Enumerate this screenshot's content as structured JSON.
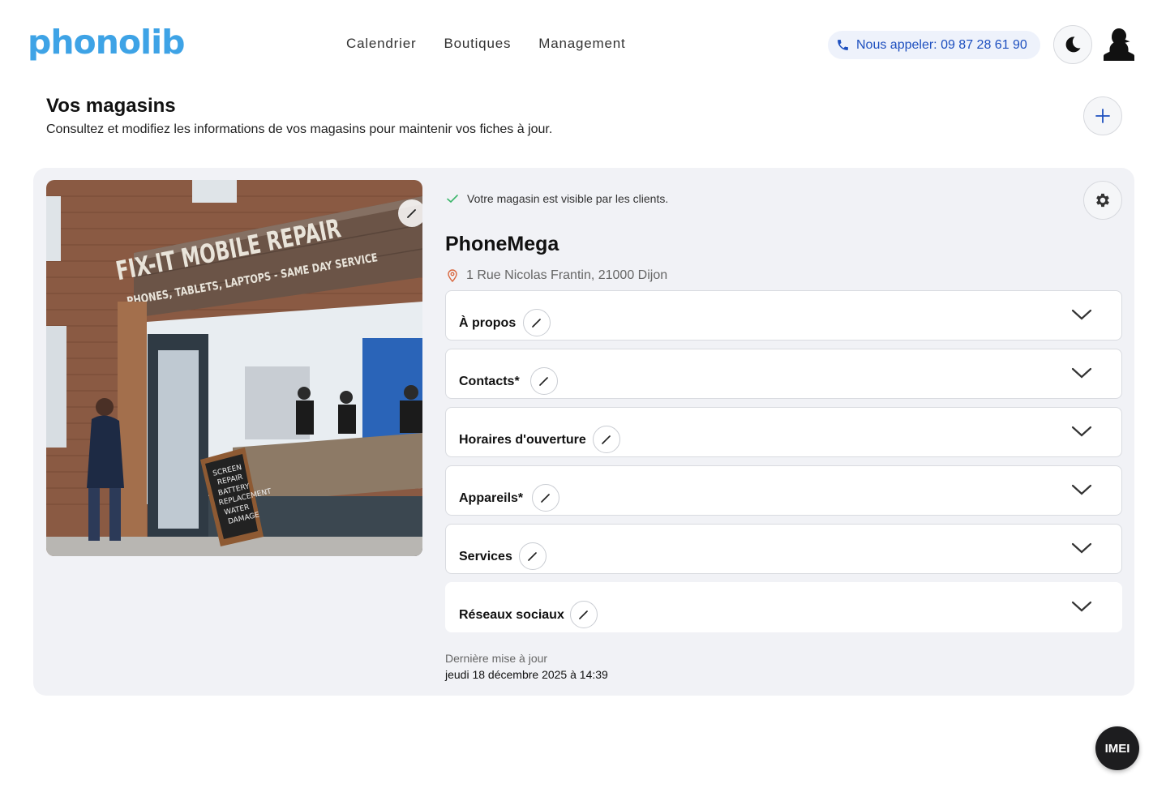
{
  "brand": {
    "logo_text": "phonolib",
    "color": "#3ea3e6"
  },
  "nav": {
    "items": [
      "Calendrier",
      "Boutiques",
      "Management"
    ]
  },
  "header": {
    "call_label": "Nous appeler: 09 87 28 61 90",
    "call_color": "#1d4fbf"
  },
  "page": {
    "title": "Vos magasins",
    "subtitle": "Consultez et modifiez les informations de vos magasins pour maintenir vos fiches à jour."
  },
  "store": {
    "visibility_text": "Votre magasin est visible par les clients.",
    "name": "PhoneMega",
    "address": "1 Rue Nicolas Frantin, 21000 Dijon",
    "photo": {
      "sign_main": "FIX-IT MOBILE REPAIR",
      "sign_sub": "PHONES, TABLETS, LAPTOPS - SAME DAY SERVICE",
      "board_text": [
        "SCREEN",
        "REPAIR",
        "BATTERY",
        "REPLACEMENT",
        "WATER",
        "DAMAGE"
      ]
    },
    "sections": [
      {
        "label": "À propos"
      },
      {
        "label": "Contacts*"
      },
      {
        "label": "Horaires d'ouverture"
      },
      {
        "label": "Appareils*"
      },
      {
        "label": "Services"
      },
      {
        "label": "Réseaux sociaux"
      }
    ],
    "last_update_label": "Dernière mise à jour",
    "last_update_value": "jeudi 18 décembre 2025 à 14:39"
  },
  "fab": {
    "label": "IMEI"
  },
  "colors": {
    "accent": "#1d4fbf",
    "success": "#3bb56a",
    "card_bg": "#f1f2f6"
  }
}
